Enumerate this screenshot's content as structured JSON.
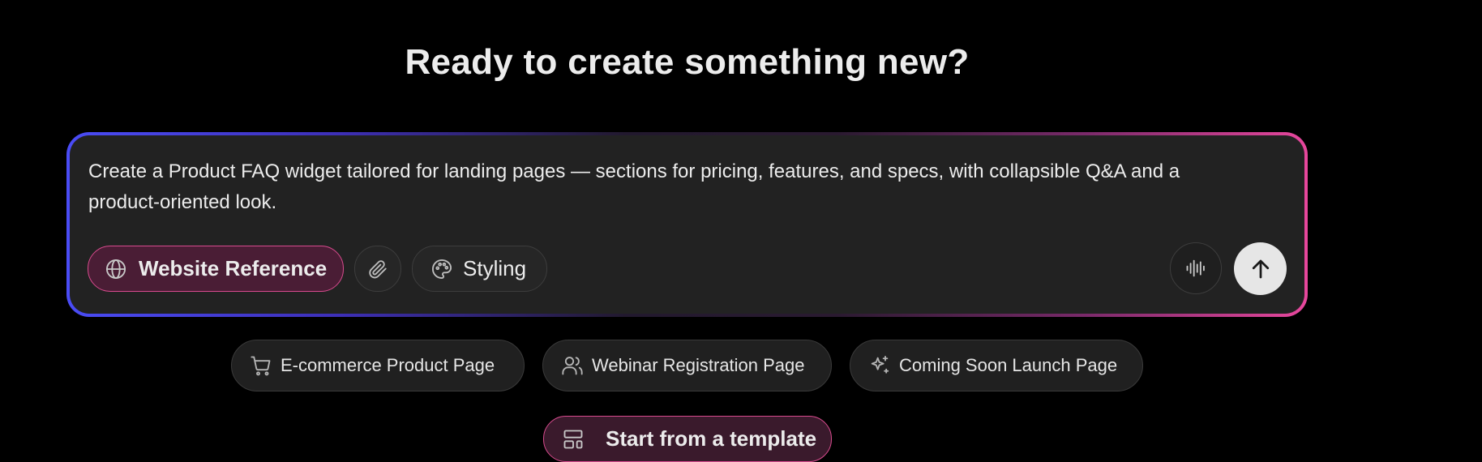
{
  "heading": "Ready to create something new?",
  "composer": {
    "prompt": "Create a Product FAQ widget tailored for landing pages — sections for pricing, features, and specs, with collapsible Q&A and a product-oriented look.",
    "website_reference_label": "Website Reference",
    "styling_label": "Styling",
    "icons": {
      "website_reference": "globe-icon",
      "attach": "paperclip-icon",
      "styling": "palette-icon",
      "voice": "audio-waveform-icon",
      "send": "arrow-up-icon"
    }
  },
  "suggestions": [
    {
      "label": "E-commerce Product Page",
      "icon": "shopping-cart-icon"
    },
    {
      "label": "Webinar Registration Page",
      "icon": "users-icon"
    },
    {
      "label": "Coming Soon Launch Page",
      "icon": "sparkles-icon"
    }
  ],
  "template_button": {
    "label": "Start from a template",
    "icon": "layout-template-icon"
  },
  "colors": {
    "background": "#000000",
    "composer_bg": "#222222",
    "gradient_start": "#4a4cf6",
    "gradient_end": "#e8479d",
    "accent_pink": "#d84b8e",
    "accent_pill_bg": "#4a1d35",
    "send_button_bg": "#e6e6e6"
  }
}
